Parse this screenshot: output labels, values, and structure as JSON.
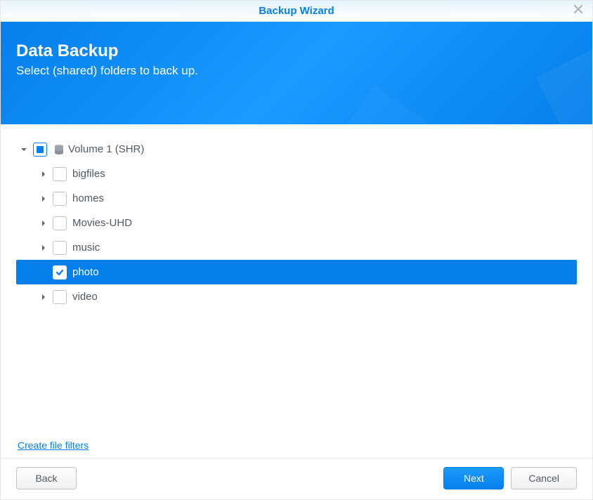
{
  "dialog": {
    "title": "Backup Wizard"
  },
  "header": {
    "title": "Data Backup",
    "subtitle": "Select (shared) folders to back up."
  },
  "tree": {
    "root": {
      "label": "Volume 1 (SHR)",
      "expanded": true,
      "checkState": "indeterminate"
    },
    "items": [
      {
        "label": "bigfiles",
        "expanded": false,
        "checked": false,
        "selected": false
      },
      {
        "label": "homes",
        "expanded": false,
        "checked": false,
        "selected": false
      },
      {
        "label": "Movies-UHD",
        "expanded": false,
        "checked": false,
        "selected": false
      },
      {
        "label": "music",
        "expanded": false,
        "checked": false,
        "selected": false
      },
      {
        "label": "photo",
        "expanded": false,
        "checked": true,
        "selected": true
      },
      {
        "label": "video",
        "expanded": false,
        "checked": false,
        "selected": false
      }
    ]
  },
  "links": {
    "create_filters": "Create file filters"
  },
  "buttons": {
    "back": "Back",
    "next": "Next",
    "cancel": "Cancel"
  }
}
